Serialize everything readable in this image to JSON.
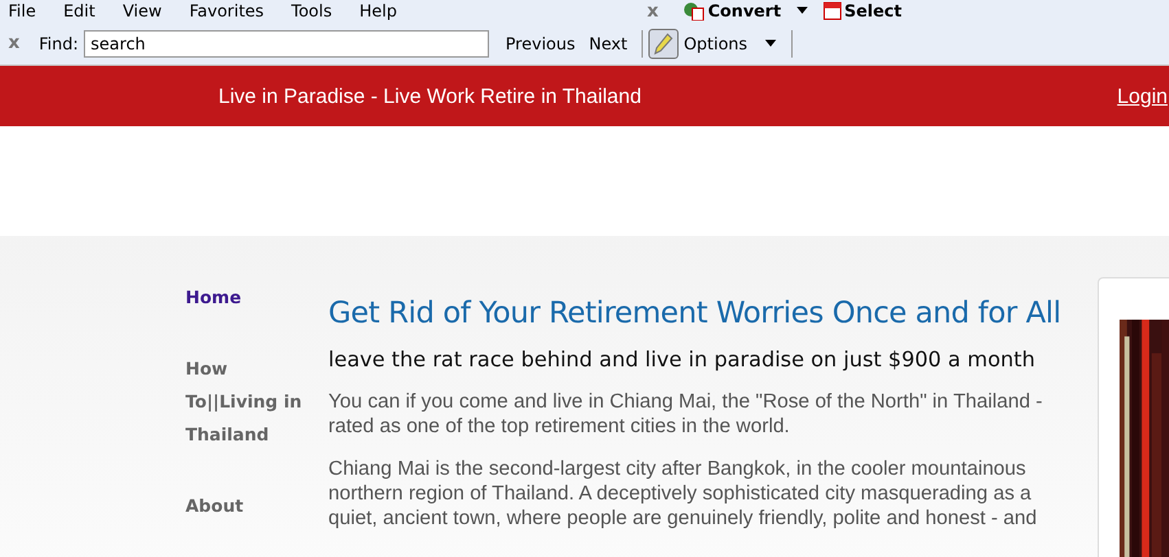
{
  "menu_bar": {
    "items": [
      "File",
      "Edit",
      "View",
      "Favorites",
      "Tools",
      "Help"
    ],
    "close": "x",
    "convert": "Convert",
    "select": "Select"
  },
  "find_bar": {
    "close": "x",
    "label": "Find:",
    "value": "search",
    "previous": "Previous",
    "next": "Next",
    "options": "Options"
  },
  "header": {
    "title": "Live in Paradise - Live Work Retire in Thailand",
    "login": "Login"
  },
  "sidebar": {
    "items": [
      {
        "label": "Home",
        "selected": true
      },
      {
        "label": "How To||Living in Thailand",
        "selected": false
      },
      {
        "label": "About",
        "selected": false
      }
    ]
  },
  "article": {
    "title": "Get Rid of Your Retirement Worries Once and for All",
    "subtitle": "leave the rat race behind and live in paradise on just $900 a month",
    "paragraphs": [
      "You can if you come and live in Chiang Mai, the \"Rose of the North\" in Thailand - rated as one of the top retirement cities in the world.",
      "Chiang Mai is the second-largest city after Bangkok, in the cooler mountainous northern region of Thailand. A deceptively sophisticated city masquerading as a quiet, ancient town, where people are genuinely friendly, polite and honest - and"
    ]
  }
}
